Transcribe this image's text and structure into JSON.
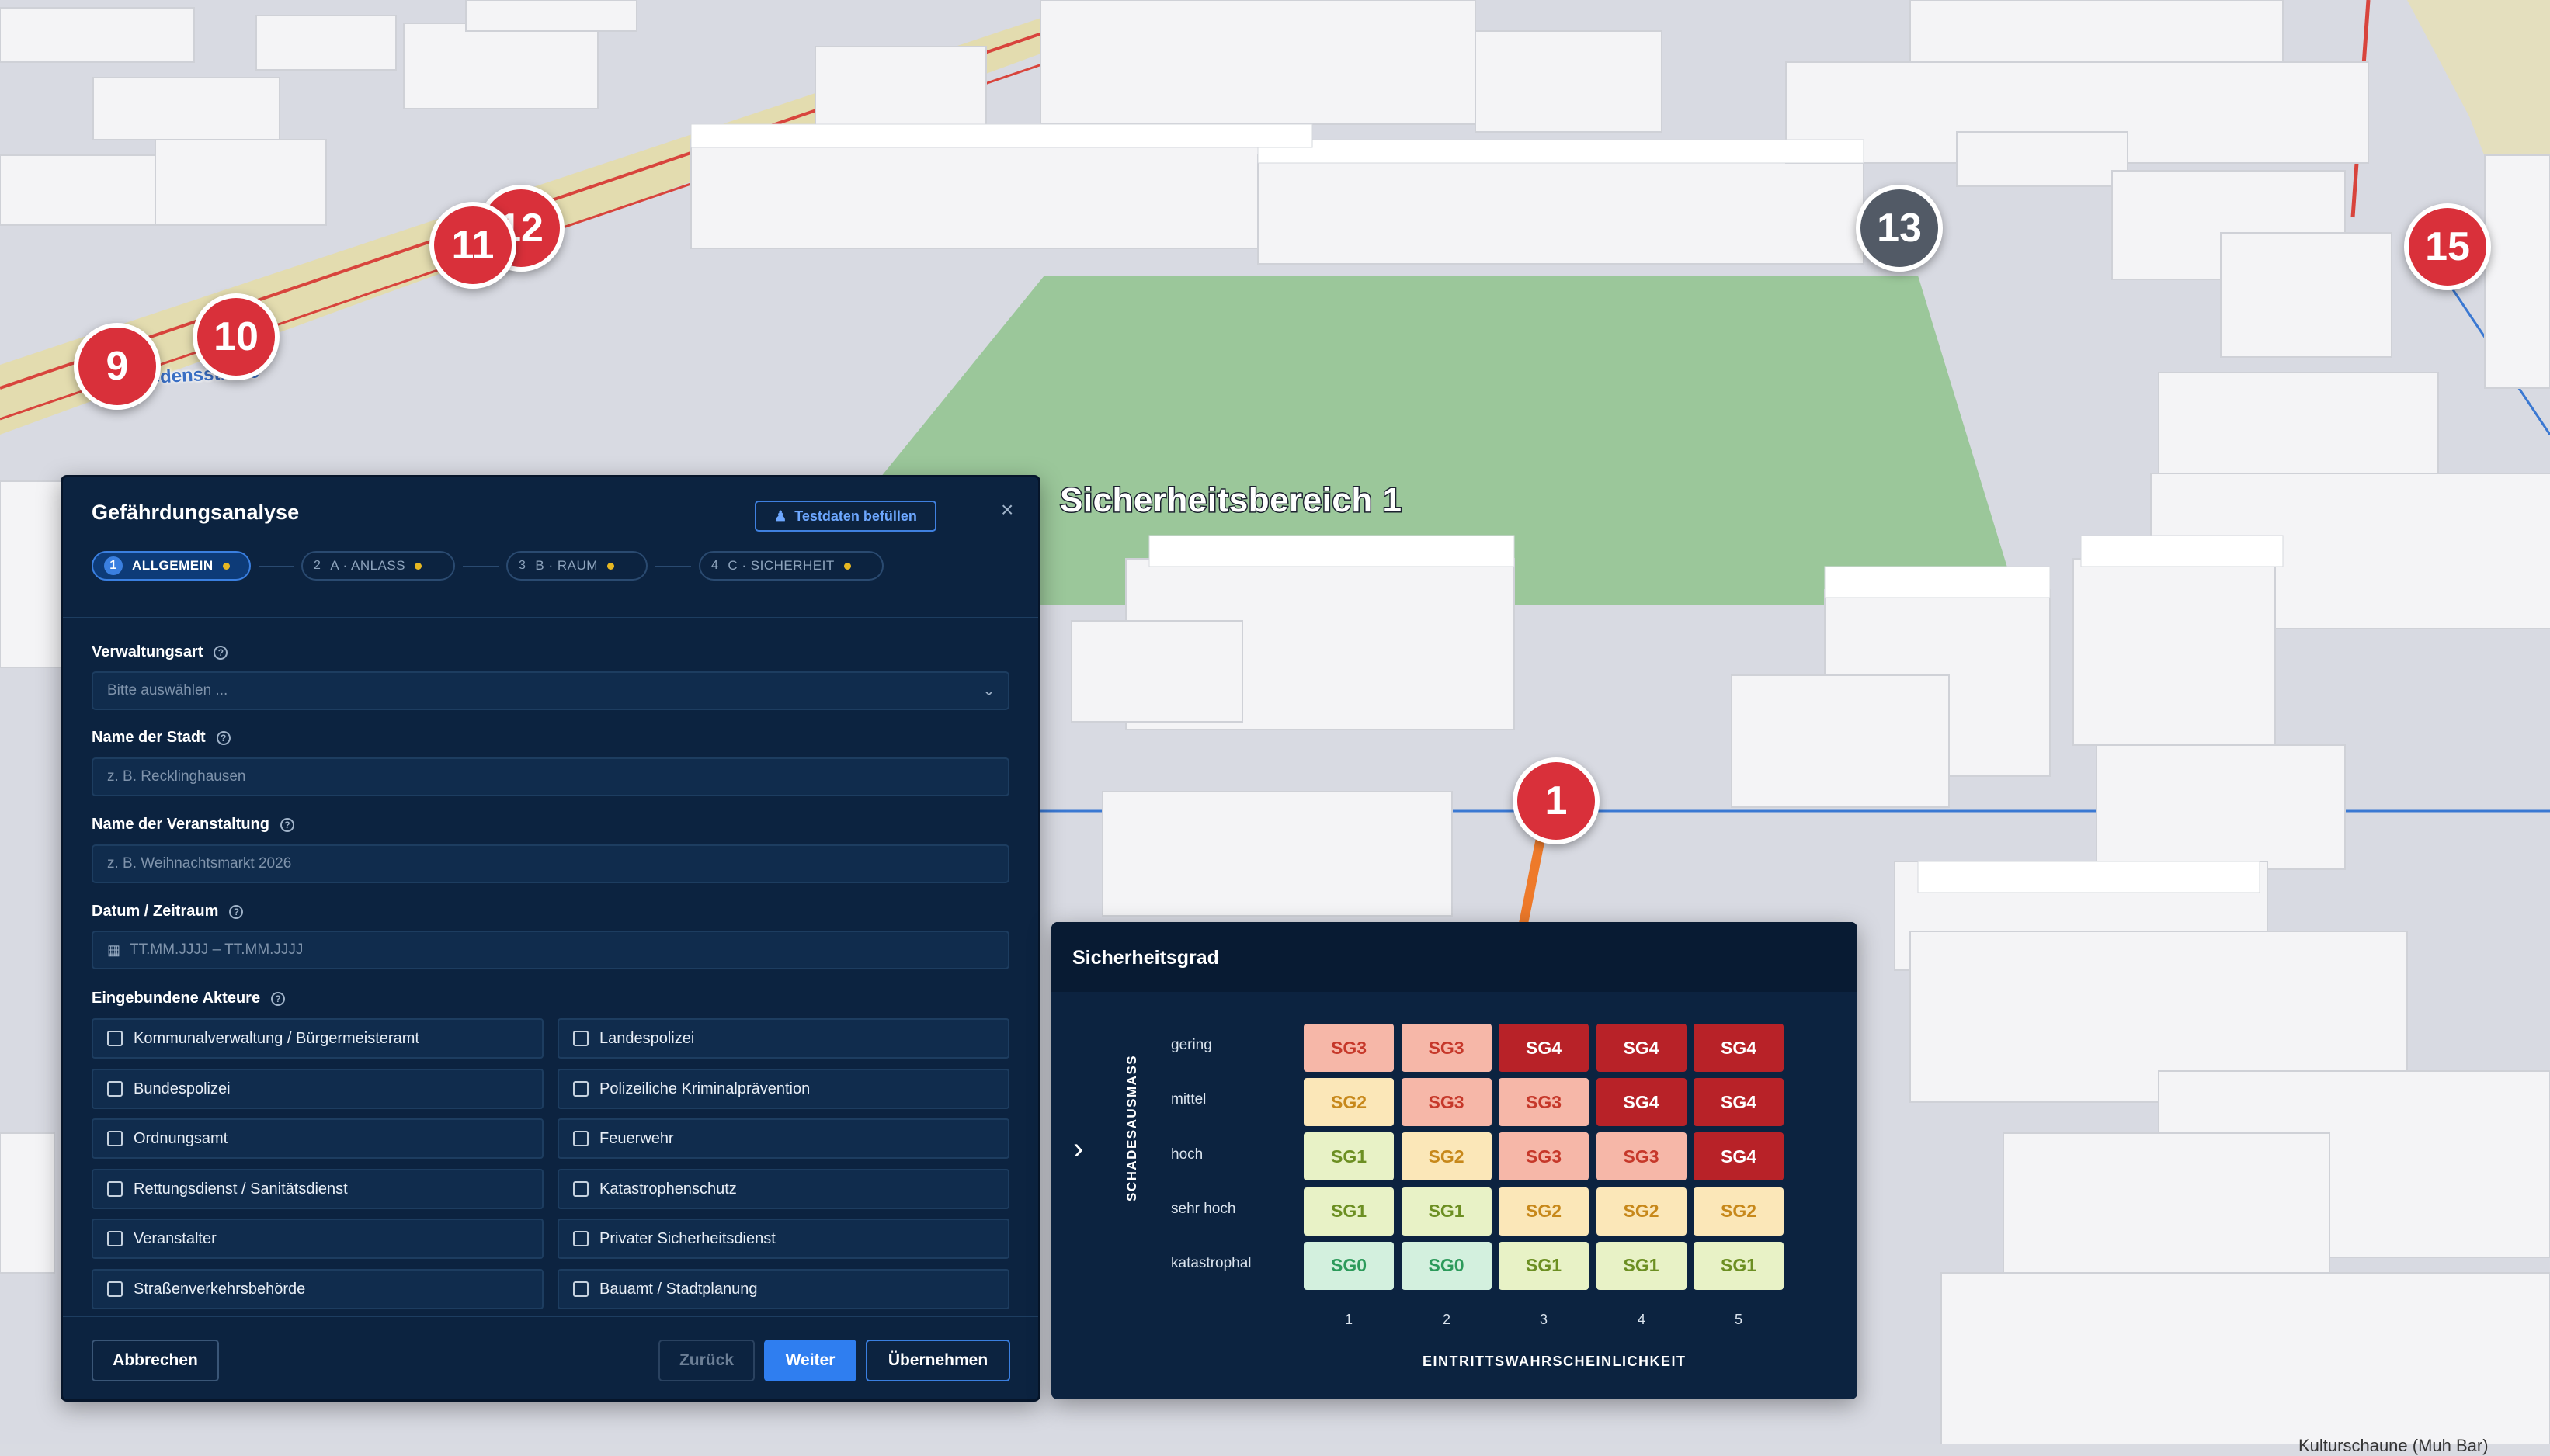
{
  "map": {
    "street_label": "Friedensstraße",
    "zone_label": "Sicherheitsbereich 1",
    "bottom_label": "Kulturschaune (Muh Bar)",
    "markers": [
      "9",
      "10",
      "11",
      "12",
      "13",
      "15",
      "1"
    ]
  },
  "dialog": {
    "title": "Gefährdungsanalyse",
    "test_button": "Testdaten befüllen",
    "close_icon": "×",
    "steps": [
      {
        "num": "1",
        "label": "ALLGEMEIN"
      },
      {
        "num": "2",
        "label": "A · ANLASS"
      },
      {
        "num": "3",
        "label": "B · RAUM"
      },
      {
        "num": "4",
        "label": "C · SICHERHEIT"
      }
    ],
    "fields": {
      "verwaltungsart": {
        "label": "Verwaltungsart",
        "placeholder": "Bitte auswählen ..."
      },
      "stadt": {
        "label": "Name der Stadt",
        "placeholder": "z. B. Recklinghausen"
      },
      "veranstaltung": {
        "label": "Name der Veranstaltung",
        "placeholder": "z. B. Weihnachtsmarkt 2026"
      },
      "datum": {
        "label": "Datum / Zeitraum",
        "placeholder": "TT.MM.JJJJ – TT.MM.JJJJ"
      },
      "akteure": {
        "label": "Eingebundene Akteure"
      }
    },
    "akteure": [
      "Kommunalverwaltung / Bürgermeisteramt",
      "Landespolizei",
      "Bundespolizei",
      "Polizeiliche Kriminalprävention",
      "Ordnungsamt",
      "Feuerwehr",
      "Rettungsdienst / Sanitätsdienst",
      "Katastrophenschutz",
      "Veranstalter",
      "Privater Sicherheitsdienst",
      "Straßenverkehrsbehörde",
      "Bauamt / Stadtplanung"
    ],
    "buttons": {
      "cancel": "Abbrechen",
      "back": "Zurück",
      "next": "Weiter",
      "apply": "Übernehmen"
    }
  },
  "sicherheitsgrad": {
    "title": "Sicherheitsgrad",
    "y_title": "SCHADESAUSMASS",
    "x_title": "EINTRITTSWAHRSCHEINLICHKEIT",
    "rows": [
      "gering",
      "mittel",
      "hoch",
      "sehr hoch",
      "katastrophal"
    ],
    "cols": [
      "1",
      "2",
      "3",
      "4",
      "5"
    ],
    "matrix": [
      [
        "SG3",
        "SG3",
        "SG4",
        "SG4",
        "SG4"
      ],
      [
        "SG2",
        "SG3",
        "SG3",
        "SG4",
        "SG4"
      ],
      [
        "SG1",
        "SG2",
        "SG3",
        "SG3",
        "SG4"
      ],
      [
        "SG1",
        "SG1",
        "SG2",
        "SG2",
        "SG2"
      ],
      [
        "SG0",
        "SG0",
        "SG1",
        "SG1",
        "SG1"
      ]
    ],
    "colors": {
      "SG0": {
        "bg": "#d3f0de",
        "fg": "#2c9a5a"
      },
      "SG1": {
        "bg": "#e8f2c6",
        "fg": "#6c8f22"
      },
      "SG2": {
        "bg": "#fbe7b8",
        "fg": "#c7881a"
      },
      "SG3": {
        "bg": "#f6b7a8",
        "fg": "#c6382a"
      },
      "SG4": {
        "bg": "#b82228",
        "fg": "#ffffff"
      }
    }
  }
}
